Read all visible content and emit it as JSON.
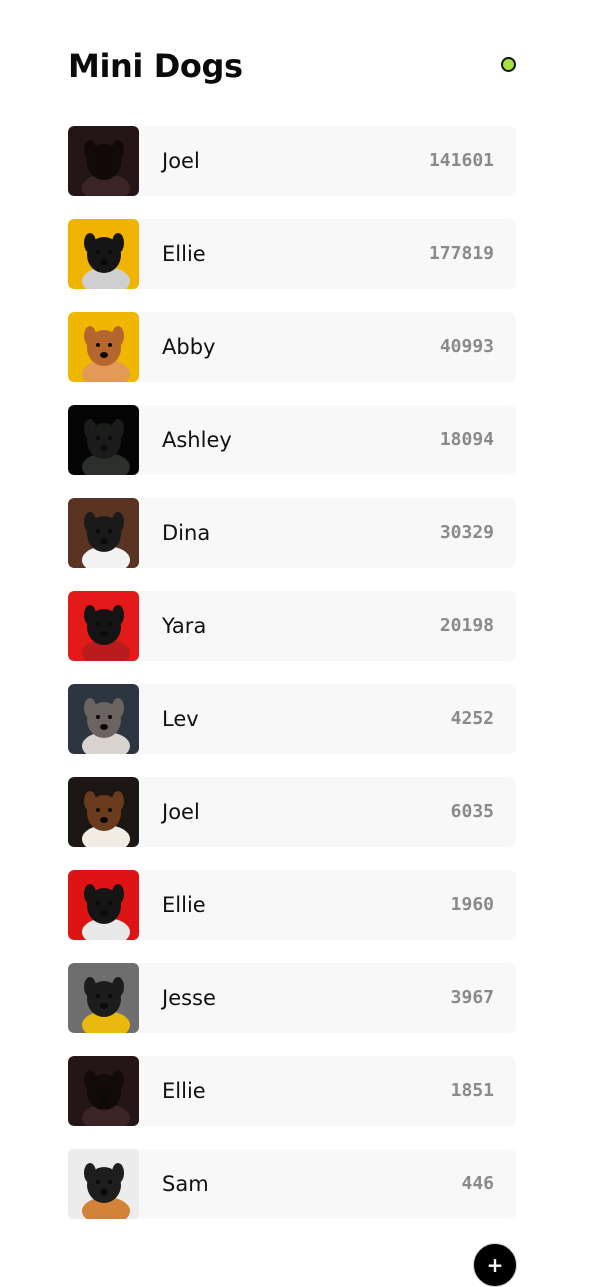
{
  "header": {
    "title": "Mini Dogs",
    "status_color": "#a6e23f"
  },
  "dogs": [
    {
      "name": "Joel",
      "count": "141601",
      "photo_bg": "#241617",
      "dog_color": "#120909",
      "accent": "#3a2424"
    },
    {
      "name": "Ellie",
      "count": "177819",
      "photo_bg": "#f0b400",
      "dog_color": "#151515",
      "accent": "#cfcfcf"
    },
    {
      "name": "Abby",
      "count": "40993",
      "photo_bg": "#f0b700",
      "dog_color": "#b5652e",
      "accent": "#e39a58"
    },
    {
      "name": "Ashley",
      "count": "18094",
      "photo_bg": "#050505",
      "dog_color": "#1b1d1b",
      "accent": "#2c302c"
    },
    {
      "name": "Dina",
      "count": "30329",
      "photo_bg": "#5b3323",
      "dog_color": "#1a1a1a",
      "accent": "#f2f2f2"
    },
    {
      "name": "Yara",
      "count": "20198",
      "photo_bg": "#e41a1a",
      "dog_color": "#141414",
      "accent": "#b91c1c"
    },
    {
      "name": "Lev",
      "count": "4252",
      "photo_bg": "#2c3540",
      "dog_color": "#6b6460",
      "accent": "#d8d3cc"
    },
    {
      "name": "Joel",
      "count": "6035",
      "photo_bg": "#1c1714",
      "dog_color": "#6a3c1d",
      "accent": "#f1ece4"
    },
    {
      "name": "Ellie",
      "count": "1960",
      "photo_bg": "#de1414",
      "dog_color": "#151515",
      "accent": "#e8e8e8"
    },
    {
      "name": "Jesse",
      "count": "3967",
      "photo_bg": "#6e6e6e",
      "dog_color": "#1c1c1c",
      "accent": "#e9b90f"
    },
    {
      "name": "Ellie",
      "count": "1851",
      "photo_bg": "#241617",
      "dog_color": "#120909",
      "accent": "#3a2424"
    },
    {
      "name": "Sam",
      "count": "446",
      "photo_bg": "#ececec",
      "dog_color": "#1e1e1e",
      "accent": "#d3823a"
    }
  ],
  "fab": {
    "label": "+"
  }
}
